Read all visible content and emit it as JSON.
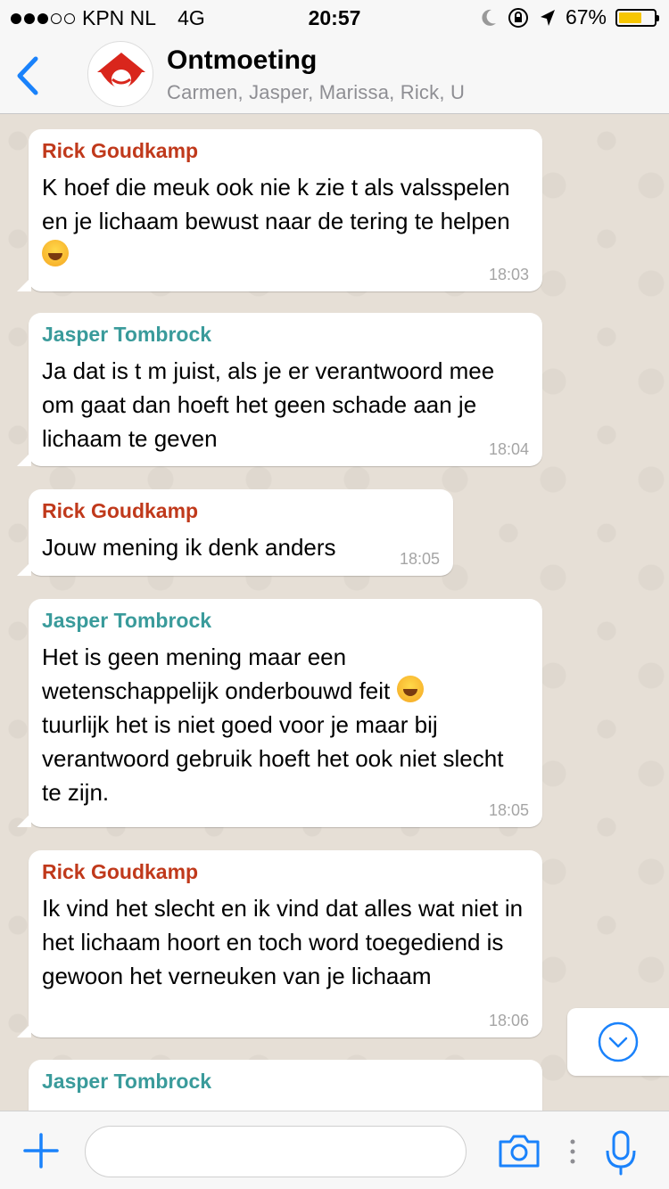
{
  "status_bar": {
    "carrier": "KPN NL",
    "network": "4G",
    "time": "20:57",
    "battery_percent": "67%",
    "battery_level": 0.67,
    "signal_bars": 3,
    "signal_total": 5
  },
  "header": {
    "title": "Ontmoeting",
    "members": "Carmen, Jasper, Marissa, Rick, U"
  },
  "messages": [
    {
      "sender": "Rick Goudkamp",
      "text": "K hoef die meuk ook nie k zie t als valsspelen en je lichaam bewust naar de tering te helpen",
      "emoji": "face-with-tears-of-joy",
      "time": "18:03"
    },
    {
      "sender": "Jasper Tombrock",
      "text": "Ja dat is t m juist, als je er verantwoord mee om gaat dan hoeft het geen schade aan je lichaam te geven",
      "time": "18:04"
    },
    {
      "sender": "Rick Goudkamp",
      "text": "Jouw mening ik denk anders",
      "time": "18:05"
    },
    {
      "sender": "Jasper Tombrock",
      "text_a": "Het is geen mening maar een wetenschappelijk onderbouwd feit",
      "emoji": "face-with-tears-of-joy",
      "text_b": "tuurlijk het is niet goed voor je maar bij verantwoord gebruik hoeft het ook niet slecht te zijn.",
      "time": "18:05"
    },
    {
      "sender": "Rick Goudkamp",
      "text": "Ik vind het slecht en ik vind dat alles wat niet in het lichaam hoort en toch word toegediend is gewoon het verneuken van je lichaam",
      "time": "18:06"
    },
    {
      "sender": "Jasper Tombrock"
    }
  ],
  "input": {
    "placeholder": ""
  },
  "colors": {
    "accent_blue": "#1a82fb",
    "rick_name": "#c0391b",
    "jasper_name": "#3a9b9b",
    "chat_background": "#e6dfd6",
    "battery_fill": "#f6c602"
  },
  "icons": [
    "back-chevron-icon",
    "group-avatar-icon",
    "moon-icon",
    "rotation-lock-icon",
    "location-arrow-icon",
    "battery-icon",
    "chevron-down-circle-icon",
    "plus-icon",
    "camera-icon",
    "more-dots-icon",
    "microphone-icon"
  ]
}
